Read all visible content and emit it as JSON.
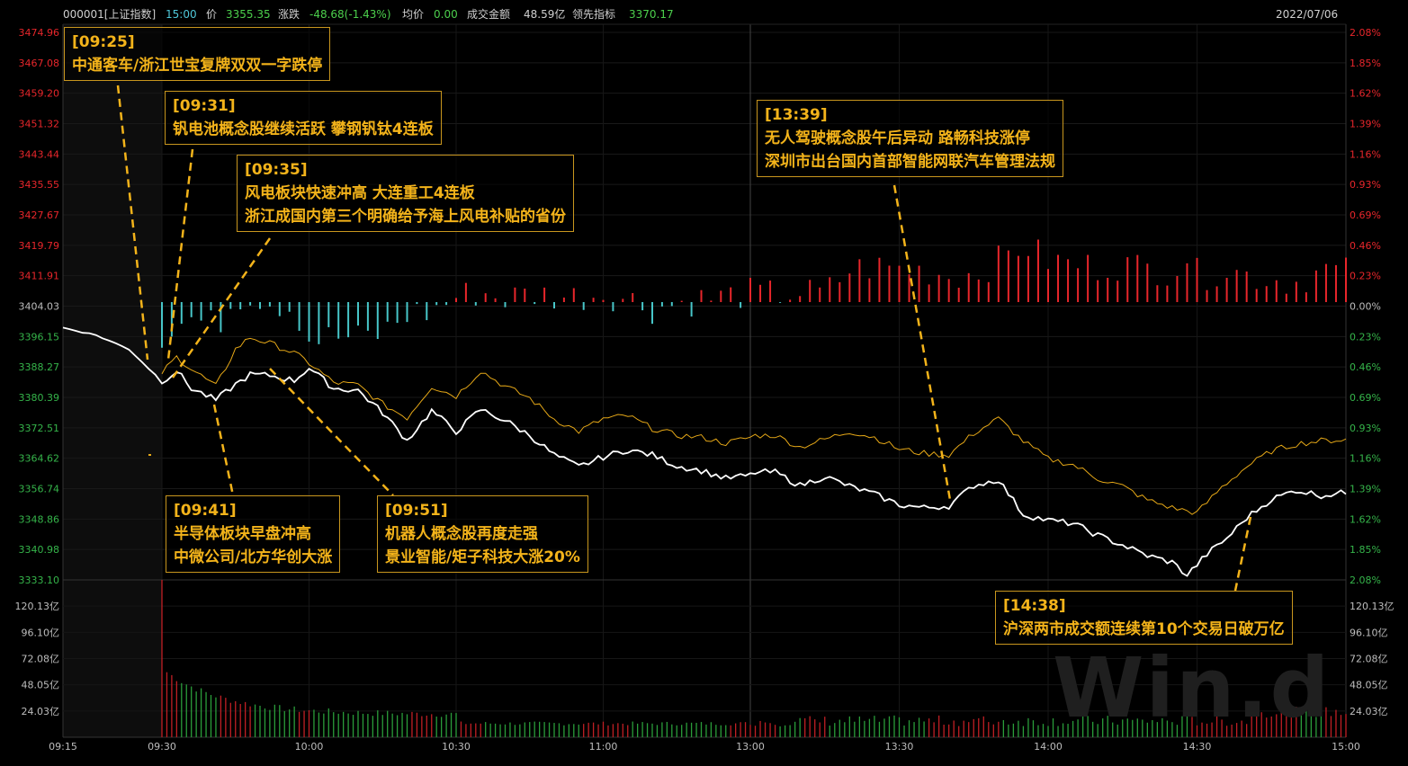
{
  "header": {
    "code": "000001[上证指数]",
    "time": "15:00",
    "price_label": "价",
    "price": "3355.35",
    "change_label": "涨跌",
    "change": "-48.68(-1.43%)",
    "avg_label": "均价",
    "avg": "0.00",
    "amount_label": "成交金额",
    "amount": "48.59亿",
    "lead_label": "领先指标",
    "lead": "3370.17",
    "date": "2022/07/06"
  },
  "watermark": "Win.d",
  "colors": {
    "up": "#e8262b",
    "down": "#47c6c8",
    "price_line": "#ffffff",
    "lead_line": "#e6a817",
    "grid": "#1e1e1e",
    "annotation": "#f3b31a"
  },
  "annotations": [
    {
      "time": "[09:25]",
      "lines": [
        "中通客车/浙江世宝复牌双双一字跌停"
      ]
    },
    {
      "time": "[09:31]",
      "lines": [
        "钒电池概念股继续活跃 攀钢钒钛4连板"
      ]
    },
    {
      "time": "[09:35]",
      "lines": [
        "风电板块快速冲高 大连重工4连板",
        "浙江成国内第三个明确给予海上风电补贴的省份"
      ]
    },
    {
      "time": "[09:41]",
      "lines": [
        "半导体板块早盘冲高",
        "中微公司/北方华创大涨"
      ]
    },
    {
      "time": "[09:51]",
      "lines": [
        "机器人概念股再度走强",
        "景业智能/矩子科技大涨20%"
      ]
    },
    {
      "time": "[13:39]",
      "lines": [
        "无人驾驶概念股午后异动 路畅科技涨停",
        "深圳市出台国内首部智能网联汽车管理法规"
      ]
    },
    {
      "time": "[14:38]",
      "lines": [
        "沪深两市成交额连续第10个交易日破万亿"
      ]
    }
  ],
  "chart_data": {
    "type": "line",
    "title": "",
    "prev_close": 3404.03,
    "y_price_ticks": [
      "3474.96",
      "3467.08",
      "3459.20",
      "3451.32",
      "3443.44",
      "3435.55",
      "3427.67",
      "3419.79",
      "3411.91",
      "3404.03",
      "3396.15",
      "3388.27",
      "3380.39",
      "3372.51",
      "3364.62",
      "3356.74",
      "3348.86",
      "3340.98",
      "3333.10"
    ],
    "y_pct_ticks": [
      "2.08%",
      "1.85%",
      "1.62%",
      "1.39%",
      "1.16%",
      "0.93%",
      "0.69%",
      "0.46%",
      "0.23%",
      "0.00%",
      "0.23%",
      "0.46%",
      "0.69%",
      "0.93%",
      "1.16%",
      "1.39%",
      "1.62%",
      "1.85%",
      "2.08%"
    ],
    "ylim": [
      3333.1,
      3474.96
    ],
    "volume_ticks": [
      "120.13亿",
      "96.10亿",
      "72.08亿",
      "48.05亿",
      "24.03亿"
    ],
    "volume_max": 144.16,
    "x_ticks": [
      "09:15",
      "09:30",
      "10:00",
      "10:30",
      "11:00",
      "13:00",
      "13:30",
      "14:00",
      "14:30",
      "15:00"
    ],
    "series": [
      {
        "name": "价",
        "key": "price",
        "x": [
          "09:15",
          "09:20",
          "09:25",
          "09:30",
          "09:33",
          "09:36",
          "09:41",
          "09:45",
          "09:48",
          "09:52",
          "09:57",
          "10:00",
          "10:05",
          "10:10",
          "10:15",
          "10:20",
          "10:25",
          "10:30",
          "10:35",
          "10:40",
          "10:45",
          "10:50",
          "10:55",
          "11:00",
          "11:05",
          "11:10",
          "11:15",
          "11:20",
          "11:25",
          "11:30",
          "13:05",
          "13:10",
          "13:15",
          "13:20",
          "13:25",
          "13:30",
          "13:35",
          "13:40",
          "13:45",
          "13:50",
          "13:55",
          "14:00",
          "14:05",
          "14:10",
          "14:15",
          "14:20",
          "14:25",
          "14:28",
          "14:32",
          "14:36",
          "14:40",
          "14:45",
          "14:50",
          "14:55",
          "15:00"
        ],
        "values": [
          3397.5,
          3395.6,
          3392.0,
          3383.8,
          3386.5,
          3382.0,
          3379.0,
          3383.0,
          3385.5,
          3385.3,
          3384.0,
          3387.3,
          3382.0,
          3381.5,
          3375.8,
          3368.7,
          3376.3,
          3371.0,
          3376.6,
          3373.8,
          3370.0,
          3365.0,
          3362.0,
          3364.5,
          3366.3,
          3365.0,
          3362.2,
          3361.0,
          3359.0,
          3359.8,
          3360.6,
          3357.2,
          3359.5,
          3357.0,
          3355.0,
          3352.3,
          3351.5,
          3352.0,
          3357.2,
          3358.7,
          3349.8,
          3348.3,
          3347.5,
          3344.5,
          3342.0,
          3339.3,
          3337.6,
          3334.3,
          3339.7,
          3343.7,
          3349.0,
          3353.7,
          3356.0,
          3354.7,
          3355.35
        ]
      },
      {
        "name": "领先指标",
        "key": "lead",
        "x": [
          "09:30",
          "09:33",
          "09:36",
          "09:41",
          "09:45",
          "09:48",
          "09:52",
          "09:57",
          "10:00",
          "10:05",
          "10:10",
          "10:15",
          "10:20",
          "10:25",
          "10:30",
          "10:35",
          "10:40",
          "10:45",
          "10:50",
          "10:55",
          "11:00",
          "11:05",
          "11:10",
          "11:15",
          "11:20",
          "11:25",
          "11:30",
          "13:05",
          "13:10",
          "13:15",
          "13:20",
          "13:25",
          "13:30",
          "13:35",
          "13:40",
          "13:45",
          "13:50",
          "13:55",
          "14:00",
          "14:05",
          "14:10",
          "14:15",
          "14:20",
          "14:25",
          "14:30",
          "14:35",
          "14:40",
          "14:45",
          "14:50",
          "14:55",
          "15:00"
        ],
        "values": [
          3386.0,
          3390.0,
          3387.0,
          3382.5,
          3392.0,
          3395.0,
          3393.5,
          3391.0,
          3388.5,
          3383.5,
          3382.8,
          3378.0,
          3374.5,
          3382.5,
          3380.0,
          3386.5,
          3382.5,
          3379.5,
          3374.2,
          3371.0,
          3374.2,
          3375.0,
          3371.8,
          3370.0,
          3369.5,
          3368.0,
          3369.5,
          3370.0,
          3367.0,
          3369.0,
          3371.0,
          3369.5,
          3366.5,
          3365.4,
          3365.0,
          3370.5,
          3374.3,
          3368.5,
          3364.0,
          3362.5,
          3359.0,
          3357.0,
          3353.5,
          3351.5,
          3350.2,
          3356.8,
          3362.0,
          3366.0,
          3367.8,
          3368.6,
          3368.9
        ]
      }
    ],
    "lead_diff_range_pct": [
      -0.69,
      0.69
    ],
    "volume_peak_open": 144.16
  }
}
